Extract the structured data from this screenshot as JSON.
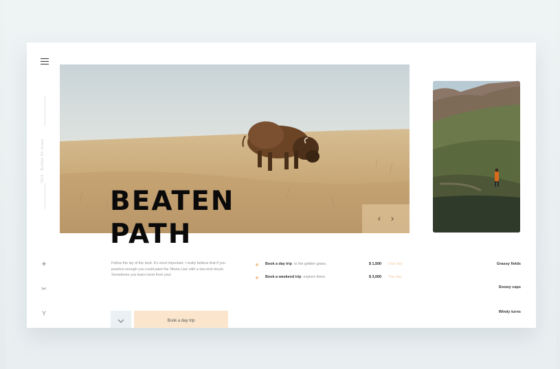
{
  "sidebar": {
    "vertical_caption": "01/3 · Buffalo On Grass",
    "icons": [
      "menu-icon",
      "plane-icon",
      "scissors-icon",
      "vine-icon"
    ]
  },
  "hero": {
    "title_line1": "BEATEN",
    "title_line2": "PATH",
    "prev_label": "‹",
    "next_label": "›"
  },
  "intro": {
    "text": "Follow the lay of the land. It's most important. I really believe that if you practice enough you could paint the 'Mona Lisa' with a two-inch brush. Sometimes you learn more from your"
  },
  "bookings": [
    {
      "strong": "Book a day trip",
      "rest": "to the golden grass.",
      "price": "$ 1,500",
      "duration": "One day"
    },
    {
      "strong": "Book a weekend trip",
      "rest": "explore there.",
      "price": "$ 3,000",
      "duration": "Two day"
    }
  ],
  "routes": [
    "Grassy fields",
    "Snowy caps",
    "Windy turns"
  ],
  "actions": {
    "toggle_glyph": "⌄",
    "cta_label": "Book a day trip"
  },
  "colors": {
    "accent": "#fbe6cd",
    "accent_dot": "#f5c79a",
    "duration_text": "#f3c79d"
  }
}
